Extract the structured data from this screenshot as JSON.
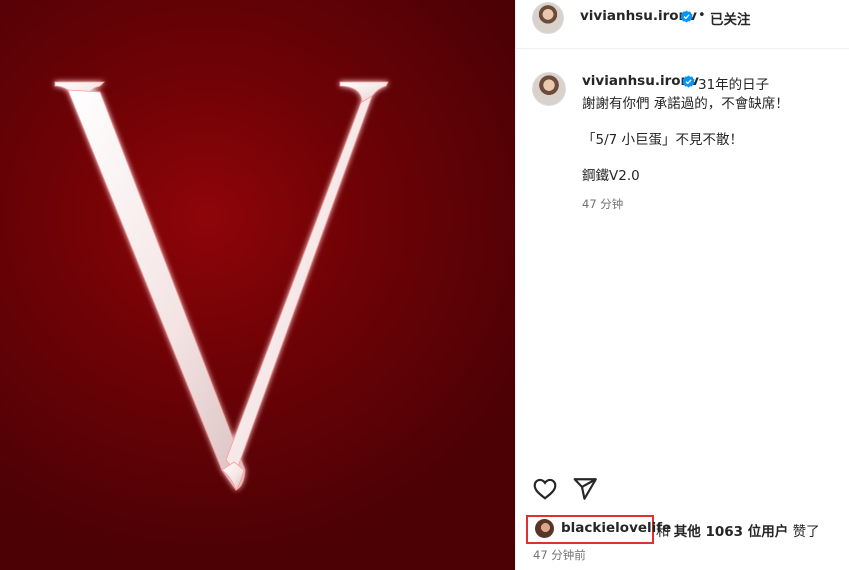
{
  "post": {
    "letter": "V",
    "colors": {
      "background": "#6d0206",
      "accent": "#e03131",
      "verified": "#0095f6"
    }
  },
  "header": {
    "username": "vivianhsu.ironv",
    "separator": "•",
    "follow_label": "已关注"
  },
  "caption": {
    "username": "vivianhsu.ironv",
    "line1": "31年的日子",
    "line2": "謝謝有你們 承諾過的，不會缺席！",
    "line3": "「5/7 小巨蛋」不見不散！",
    "line4": "鋼鐵V2.0",
    "time": "47 分钟"
  },
  "actions": {
    "like_icon": "heart-icon",
    "share_icon": "send-icon"
  },
  "likes": {
    "username": "blackielovelife",
    "text_and": "和",
    "text_others": "其他 1063 位用户",
    "text_liked": "赞了"
  },
  "post_time": "47 分钟前"
}
